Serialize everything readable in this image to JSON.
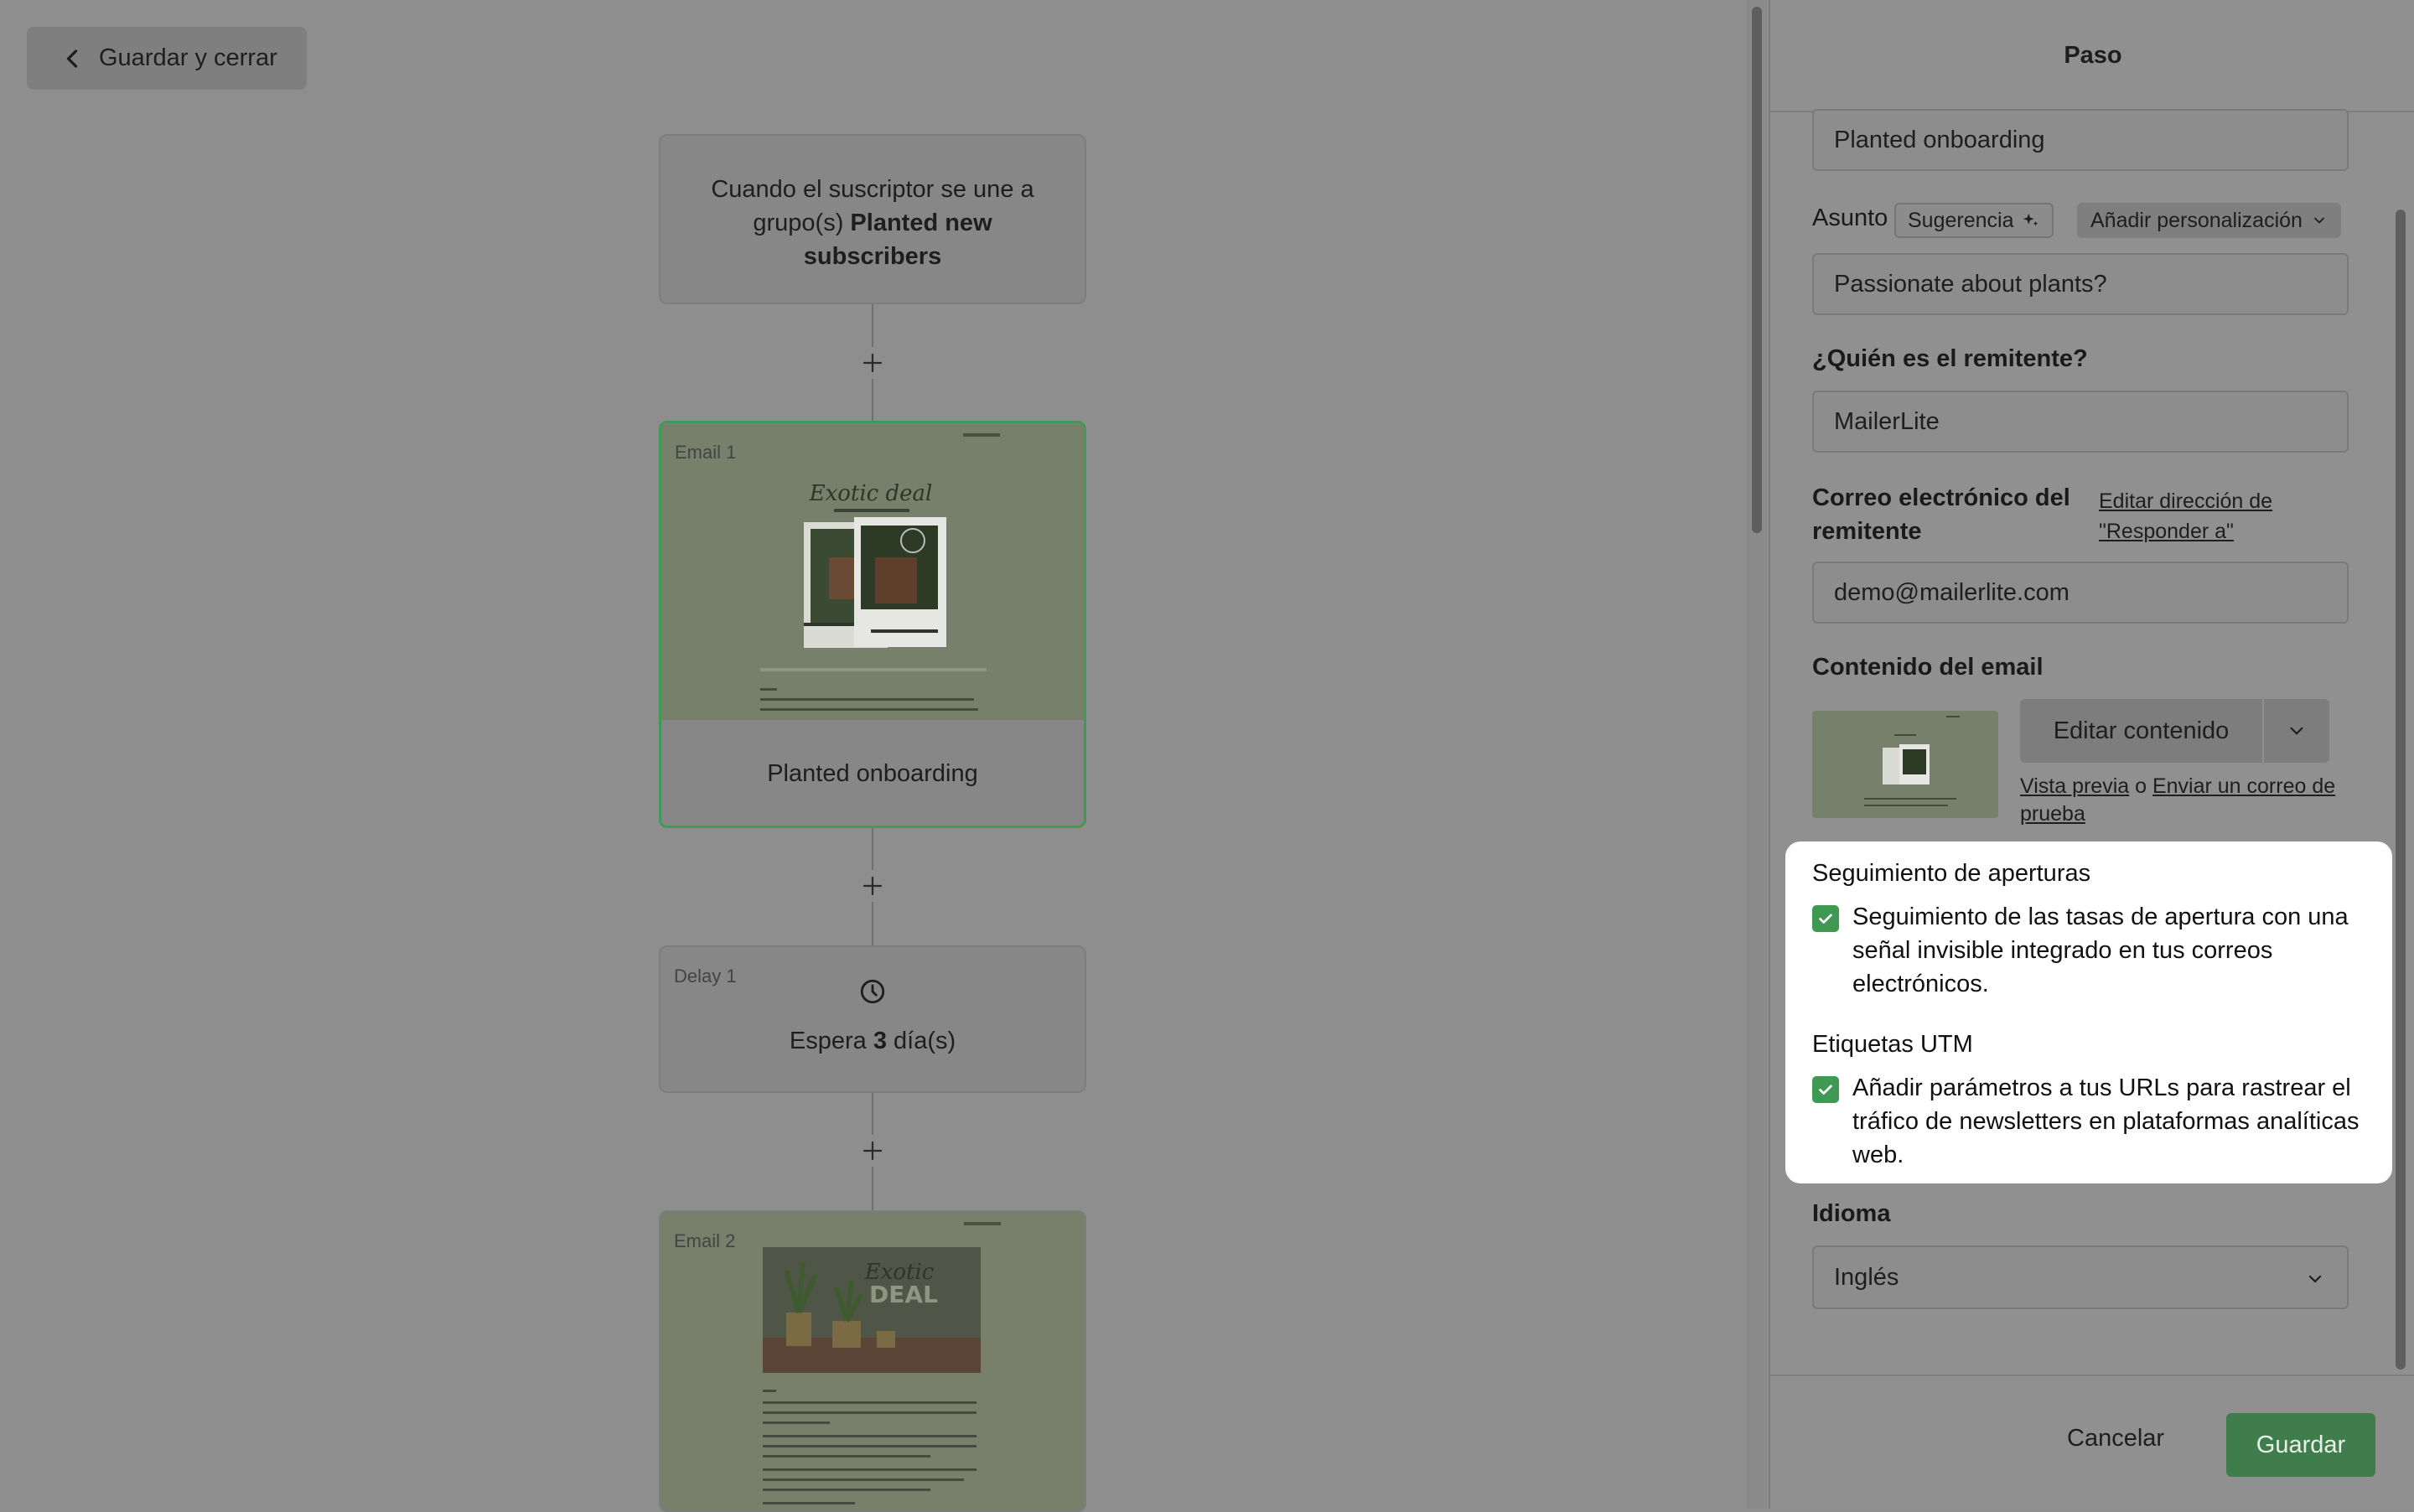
{
  "toolbar": {
    "save_close_label": "Guardar y cerrar"
  },
  "workflow": {
    "trigger": {
      "text_prefix": "Cuando el suscriptor se une a grupo(s) ",
      "group_name": "Planted new subscribers"
    },
    "email1": {
      "tag": "Email 1",
      "name": "Planted onboarding"
    },
    "delay1": {
      "tag": "Delay 1",
      "prefix": "Espera ",
      "amount": "3",
      "suffix": " día(s)"
    },
    "email2": {
      "tag": "Email 2"
    }
  },
  "panel": {
    "title": "Paso",
    "name_value": "Planted onboarding",
    "subject": {
      "label": "Asunto",
      "suggest_label": "Sugerencia",
      "personalize_label": "Añadir personalización",
      "value": "Passionate about plants?"
    },
    "sender": {
      "label": "¿Quién es el remitente?",
      "value": "MailerLite"
    },
    "sender_email": {
      "label": "Correo electrónico del remitente",
      "reply_link": "Editar dirección de \"Responder a\"",
      "value": "demo@mailerlite.com"
    },
    "content": {
      "label": "Contenido del email",
      "edit_label": "Editar contenido",
      "preview_link": "Vista previa",
      "or_text": " o ",
      "test_link": "Enviar un correo de prueba"
    },
    "open_tracking": {
      "title": "Seguimiento de aperturas",
      "checked": true,
      "text": "Seguimiento de las tasas de apertura con una señal invisible integrado en tus correos electrónicos."
    },
    "utm": {
      "title": "Etiquetas UTM",
      "checked": true,
      "text": "Añadir parámetros a tus URLs para rastrear el tráfico de newsletters en plataformas analíticas web."
    },
    "language": {
      "label": "Idioma",
      "value": "Inglés"
    },
    "footer": {
      "cancel_label": "Cancelar",
      "save_label": "Guardar"
    }
  },
  "colors": {
    "accent": "#3f9a55",
    "highlight_bg": "#ffffff",
    "overlay": "#8e8e8e"
  },
  "icons": [
    "chevron-left-icon",
    "plus-icon",
    "clock-icon",
    "sparkle-icon",
    "chevron-down-icon",
    "check-icon"
  ]
}
